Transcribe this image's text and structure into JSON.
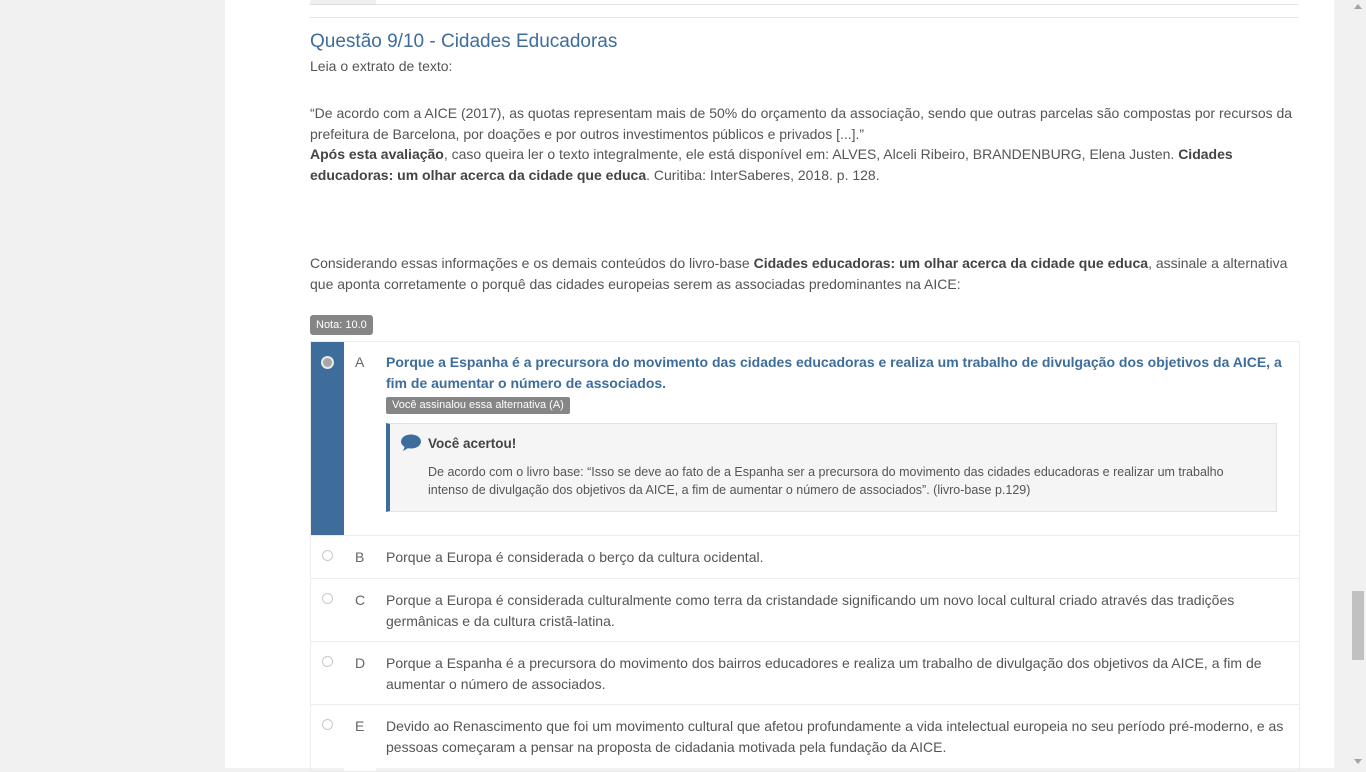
{
  "question": {
    "title": "Questão 9/10 - Cidades Educadoras",
    "intro": "Leia o extrato de texto:",
    "quote": "“De acordo com a AICE (2017), as quotas representam mais de 50% do orçamento da associação, sendo que outras parcelas são compostas por recursos da prefeitura de Barcelona, por doações e por outros investimentos públicos e privados [...].”",
    "source_bold1": "Após esta avaliação",
    "source_text1": ", caso queira ler o texto integralmente, ele está disponível em: ALVES, Alceli Ribeiro, BRANDENBURG, Elena Justen. ",
    "source_bold2": "Cidades educadoras: um olhar acerca da cidade que educa",
    "source_text2": ". Curitiba: InterSaberes, 2018. p. 128.",
    "prompt_text1": "Considerando essas informações e os demais conteúdos do livro-base ",
    "prompt_bold": "Cidades educadoras: um olhar acerca da cidade que educa",
    "prompt_text2": ", assinale a alternativa que aponta corretamente o porquê das cidades europeias serem as associadas predominantes na AICE:",
    "grade": "Nota: 10.0"
  },
  "options": [
    {
      "letter": "A",
      "text": "Porque a Espanha é a precursora do movimento das cidades educadoras e realiza um trabalho de divulgação dos objetivos da AICE, a fim de aumentar o número de associados."
    },
    {
      "letter": "B",
      "text": "Porque a Europa é considerada o berço da cultura ocidental."
    },
    {
      "letter": "C",
      "text": "Porque a Europa é considerada culturalmente como terra da cristandade significando um novo local cultural criado através das tradições germânicas e da cultura cristã-latina."
    },
    {
      "letter": "D",
      "text": "Porque a Espanha é a precursora do movimento dos bairros educadores e realiza um trabalho de divulgação dos objetivos da AICE, a fim de aumentar o número de associados."
    },
    {
      "letter": "E",
      "text": "Devido ao Renascimento que foi um movimento cultural que afetou profundamente a vida intelectual europeia no seu período pré-moderno, e as pessoas começaram a pensar na proposta de cidadania motivada pela fundação da AICE."
    }
  ],
  "selected_badge": "Você assinalou essa alternativa (A)",
  "feedback": {
    "title": "Você acertou!",
    "body": "De acordo com o livro base: “Isso se deve ao fato de a Espanha ser a precursora do movimento das cidades educadoras e realizar um trabalho intenso de divulgação dos objetivos da AICE, a fim de aumentar o número de associados”. (livro-base p.129)"
  },
  "colors": {
    "accent": "#3e6d9c",
    "badge": "#868686"
  }
}
